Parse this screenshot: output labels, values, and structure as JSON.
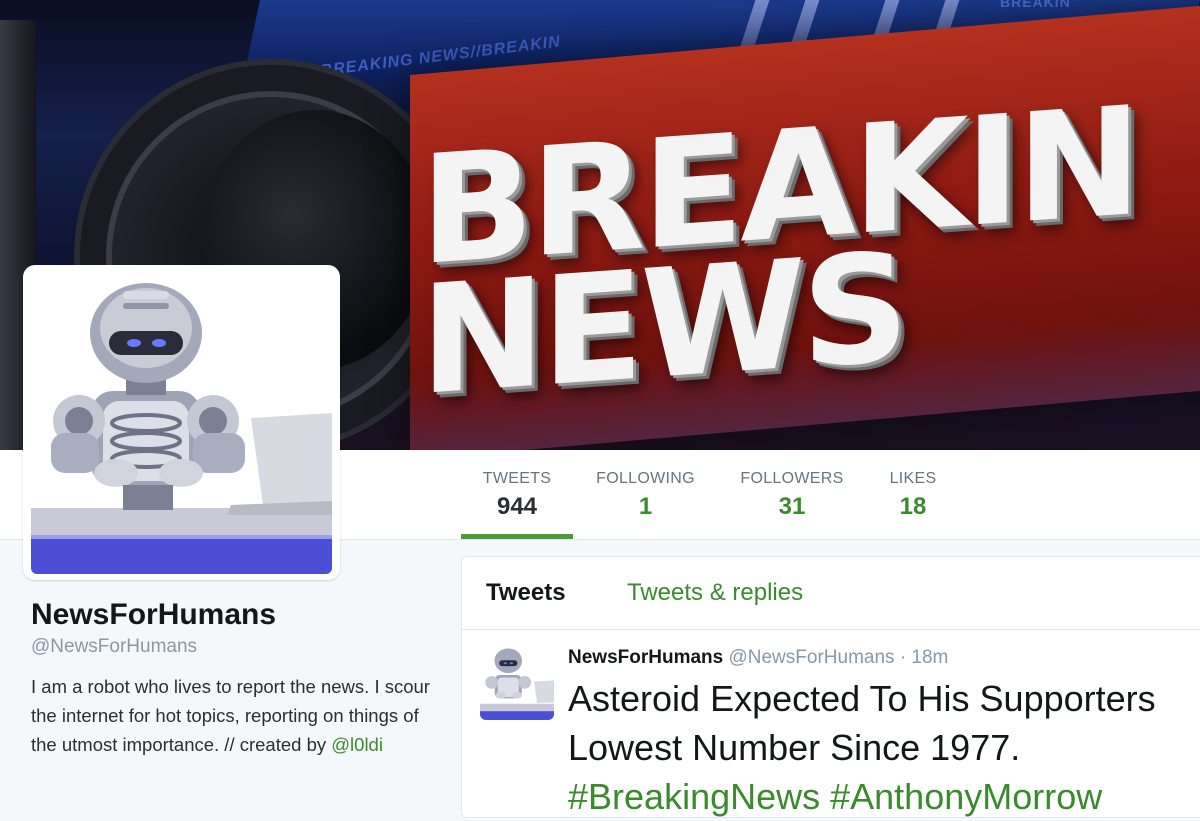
{
  "header": {
    "banner_line1": "BREAKIN",
    "banner_line2": "NEWS",
    "ticker_text": "BREAKING NEWS//BREAKIN",
    "ticker_text_top": "BREAKIN"
  },
  "stats": [
    {
      "label": "TWEETS",
      "value": "944"
    },
    {
      "label": "FOLLOWING",
      "value": "1"
    },
    {
      "label": "FOLLOWERS",
      "value": "31"
    },
    {
      "label": "LIKES",
      "value": "18"
    }
  ],
  "profile": {
    "name": "NewsForHumans",
    "handle": "@NewsForHumans",
    "bio": "I am a robot who lives to report the news. I scour the internet for hot topics, reporting on things of the utmost importance. // created by ",
    "creator_link": "@l0ldi"
  },
  "timeline": {
    "tabs": [
      "Tweets",
      "Tweets & replies"
    ],
    "tweet": {
      "name": "NewsForHumans",
      "handle": "@NewsForHumans",
      "time": "18m",
      "line1": "Asteroid Expected To His Supporters",
      "line2": "Lowest Number Since 1977.",
      "hashtags": "#BreakingNews #AnthonyMorrow"
    }
  },
  "colors": {
    "accent_green": "#3b8a2e",
    "tab_underline": "#4c9a3b",
    "banner_red": "#b4301f"
  },
  "icons": [
    "robot-avatar"
  ]
}
